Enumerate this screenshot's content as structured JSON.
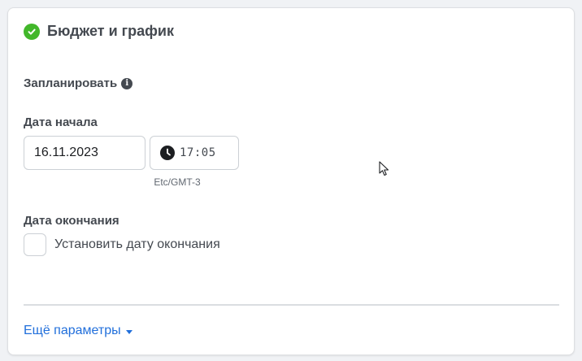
{
  "section": {
    "title": "Бюджет и график",
    "status_icon": "check-circle-icon",
    "status_color": "#42b72a"
  },
  "schedule": {
    "label": "Запланировать",
    "info_icon": "i",
    "start": {
      "label": "Дата начала",
      "date_value": "16.11.2023",
      "time_value": "17:05",
      "timezone": "Etc/GMT-3"
    },
    "end": {
      "label": "Дата окончания",
      "checkbox_label": "Установить дату окончания",
      "checked": false
    }
  },
  "more_options": {
    "label": "Ещё параметры",
    "color": "#216fdb"
  }
}
